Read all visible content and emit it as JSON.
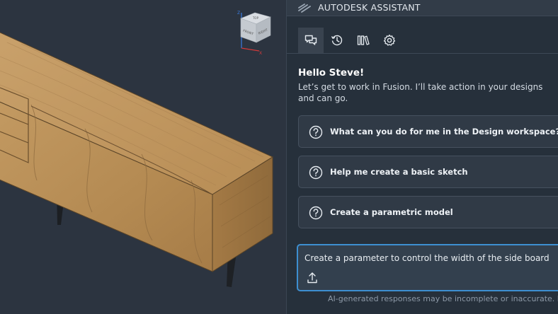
{
  "panel": {
    "title": "AUTODESK ASSISTANT",
    "tabs": [
      {
        "icon": "chat-bubbles-icon",
        "active": true
      },
      {
        "icon": "history-icon",
        "active": false
      },
      {
        "icon": "library-icon",
        "active": false
      },
      {
        "icon": "gear-icon",
        "active": false
      }
    ],
    "greeting": "Hello Steve!",
    "intro": "Let’s get to work in Fusion. I’ll take action in your designs and can go.",
    "suggestions": [
      {
        "icon": "question-circle-icon",
        "label": "What can you do for me in the Design workspace?"
      },
      {
        "icon": "question-circle-icon",
        "label": "Help me create a basic sketch"
      },
      {
        "icon": "question-circle-icon",
        "label": "Create a parametric model"
      }
    ],
    "prompt": {
      "text": "Create a parameter to control the width of the side board",
      "upload_icon": "upload-icon"
    },
    "disclaimer": "AI-generated responses may be incomplete or inaccurate. Review"
  },
  "viewcube": {
    "faces": [
      "TOP",
      "FRONT",
      "RIGHT"
    ],
    "axis_labels": [
      "Z",
      "X"
    ]
  },
  "colors": {
    "accent": "#3d8fd1",
    "panel_bg": "#26303b",
    "viewport_bg": "#2c3440",
    "wood": "#c49a62"
  }
}
